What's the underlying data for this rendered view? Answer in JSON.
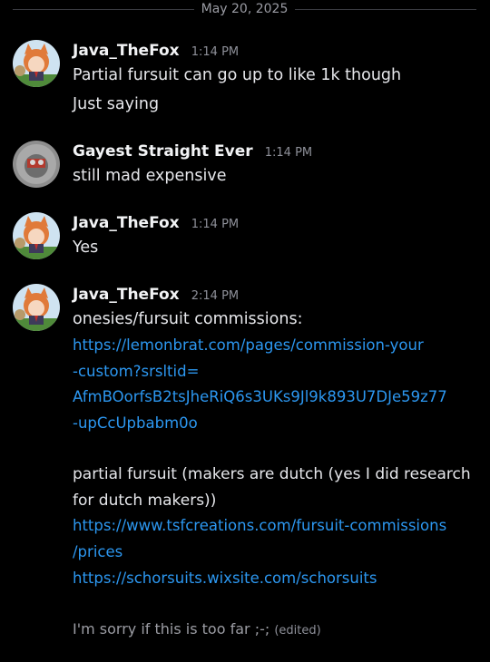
{
  "date_divider": "May 20, 2025",
  "messages": [
    {
      "username": "Java_TheFox",
      "time": "1:14 PM",
      "lines": [
        "Partial fursuit can go up to like 1k though",
        "Just saying"
      ]
    },
    {
      "username": "Gayest Straight Ever",
      "time": "1:14 PM",
      "lines": [
        "still mad expensive"
      ]
    },
    {
      "username": "Java_TheFox",
      "time": "1:14 PM",
      "lines": [
        "Yes"
      ]
    },
    {
      "username": "Java_TheFox",
      "time": "2:14 PM",
      "intro": "onesies/fursuit commissions:",
      "link1_lines": [
        "https://lemonbrat.com/pages/commission-your",
        "-custom?srsltid=",
        "AfmBOorfsB2tsJheRiQ6s3UKs9Jl9k893U7DJe59z77",
        "-upCcUpbabm0o"
      ],
      "partial_lines": [
        "partial fursuit (makers are dutch (yes I did research",
        "for dutch makers))"
      ],
      "link2_lines": [
        "https://www.tsfcreations.com/fursuit-commissions",
        "/prices"
      ],
      "link3": "https://schorsuits.wixsite.com/schorsuits",
      "last_line": "I'm sorry if this is too far ;-;",
      "edited_label": "(edited)"
    }
  ],
  "colors": {
    "background": "#000000",
    "link": "#2c97f0",
    "username": "#f2f3f5",
    "timestamp": "#8e9099"
  }
}
